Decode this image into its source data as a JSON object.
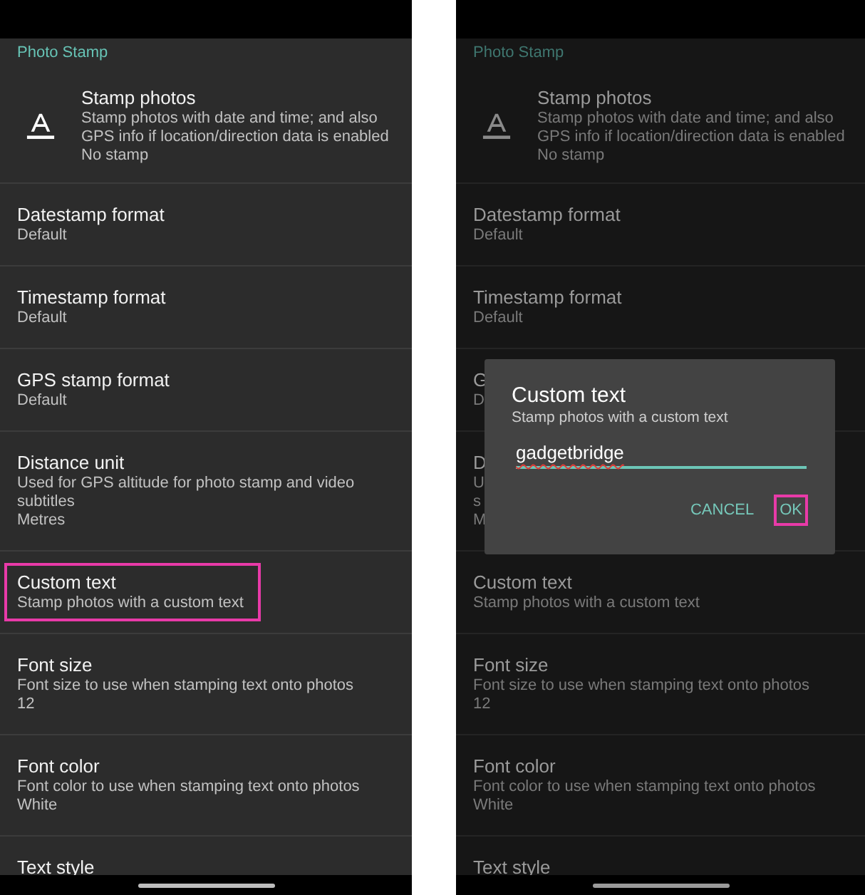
{
  "screens": [
    {
      "dimmed": false,
      "section": "Photo Stamp",
      "settings": [
        {
          "kind": "icon",
          "title": "Stamp photos",
          "lines": [
            "Stamp photos with date and time; and also GPS info if location/direction data is enabled",
            "No stamp"
          ],
          "highlighted": false
        },
        {
          "kind": "plain",
          "title": "Datestamp format",
          "lines": [
            "Default"
          ],
          "highlighted": false
        },
        {
          "kind": "plain",
          "title": "Timestamp format",
          "lines": [
            "Default"
          ],
          "highlighted": false
        },
        {
          "kind": "plain",
          "title": "GPS stamp format",
          "lines": [
            "Default"
          ],
          "highlighted": false
        },
        {
          "kind": "plain",
          "title": "Distance unit",
          "lines": [
            "Used for GPS altitude for photo stamp and video subtitles",
            "Metres"
          ],
          "highlighted": false
        },
        {
          "kind": "plain",
          "title": "Custom text",
          "lines": [
            "Stamp photos with a custom text"
          ],
          "highlighted": true
        },
        {
          "kind": "plain",
          "title": "Font size",
          "lines": [
            "Font size to use when stamping text onto photos",
            "12"
          ],
          "highlighted": false
        },
        {
          "kind": "plain",
          "title": "Font color",
          "lines": [
            "Font color to use when stamping text onto photos",
            "White"
          ],
          "highlighted": false
        },
        {
          "kind": "plain",
          "title": "Text style",
          "highlighted": false
        }
      ]
    },
    {
      "dimmed": true,
      "section": "Photo Stamp",
      "settings": [
        {
          "kind": "icon",
          "title": "Stamp photos",
          "lines": [
            "Stamp photos with date and time; and also GPS info if location/direction data is enabled",
            "No stamp"
          ],
          "highlighted": false
        },
        {
          "kind": "plain",
          "title": "Datestamp format",
          "lines": [
            "Default"
          ],
          "highlighted": false
        },
        {
          "kind": "plain",
          "title": "Timestamp format",
          "lines": [
            "Default"
          ],
          "highlighted": false
        },
        {
          "kind": "plain",
          "title": "G",
          "lines": [
            "D"
          ],
          "highlighted": false
        },
        {
          "kind": "plain",
          "title": "D",
          "lines": [
            "U",
            "s",
            "M"
          ],
          "highlighted": false
        },
        {
          "kind": "plain",
          "title": "Custom text",
          "lines": [
            "Stamp photos with a custom text"
          ],
          "highlighted": false
        },
        {
          "kind": "plain",
          "title": "Font size",
          "lines": [
            "Font size to use when stamping text onto photos",
            "12"
          ],
          "highlighted": false
        },
        {
          "kind": "plain",
          "title": "Font color",
          "lines": [
            "Font color to use when stamping text onto photos",
            "White"
          ],
          "highlighted": false
        },
        {
          "kind": "plain",
          "title": "Text style",
          "highlighted": false
        }
      ],
      "dialog": {
        "title": "Custom text",
        "message": "Stamp photos with a custom text",
        "value": "gadgetbridge",
        "misspelled": true,
        "buttons": [
          {
            "label": "CANCEL",
            "highlighted": false
          },
          {
            "label": "OK",
            "highlighted": true
          }
        ]
      }
    }
  ]
}
